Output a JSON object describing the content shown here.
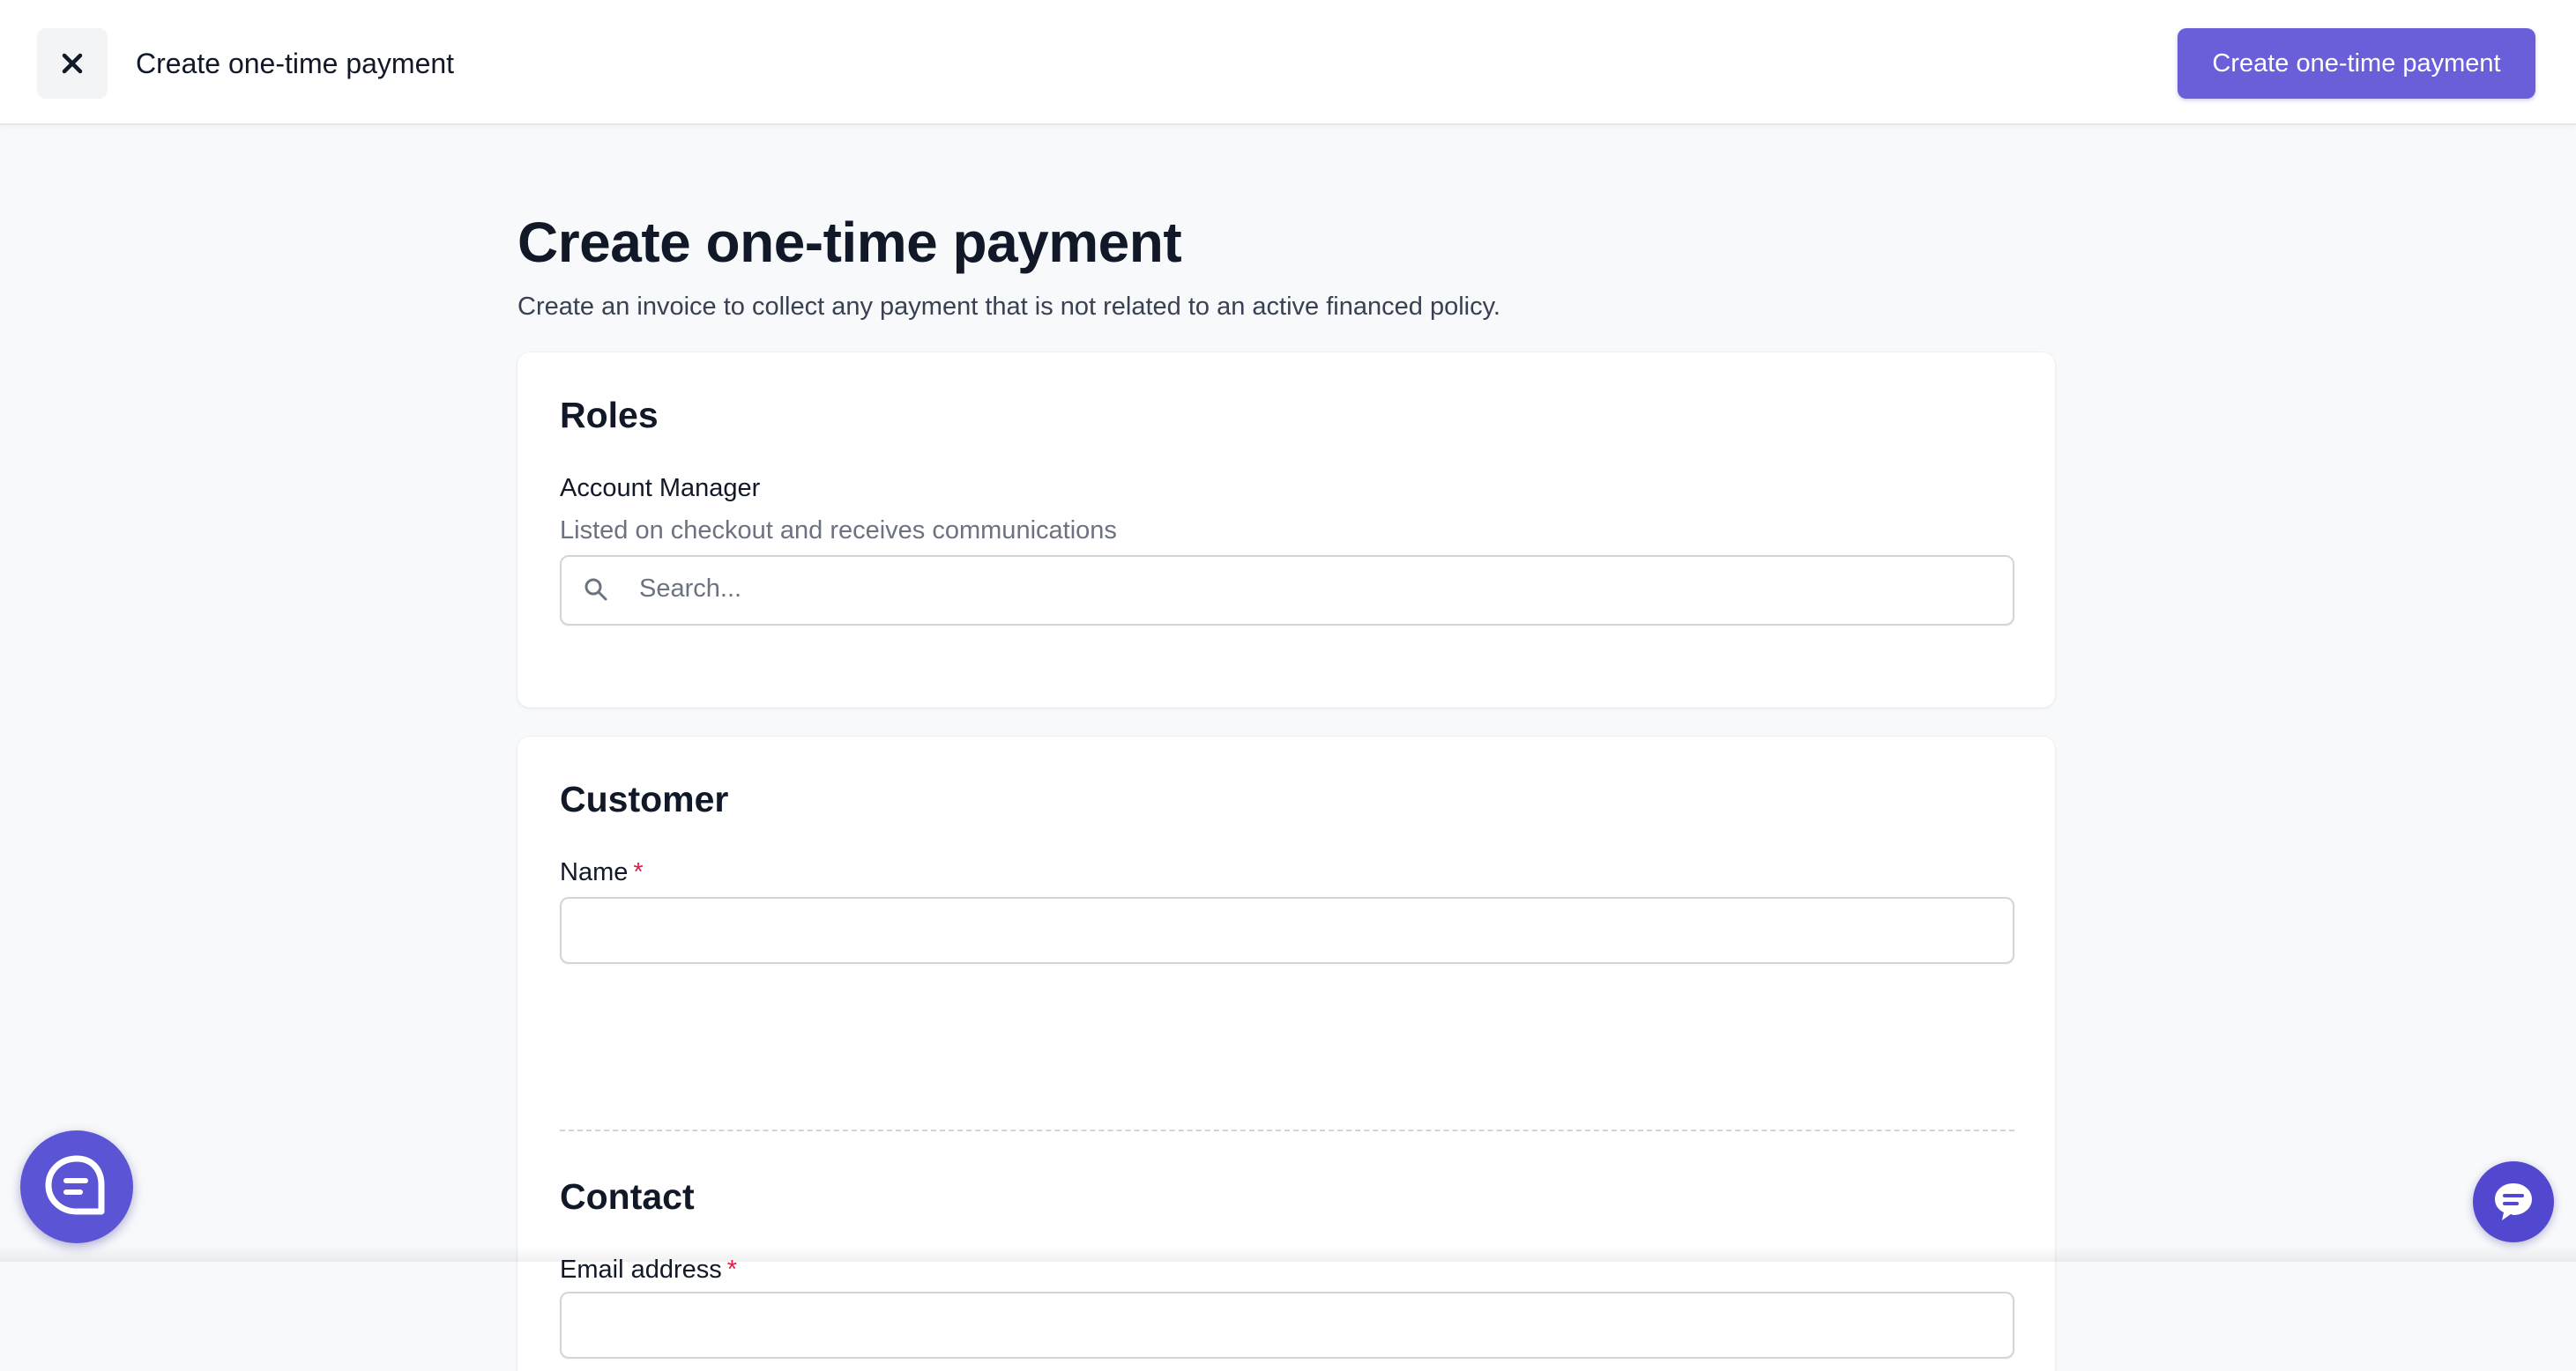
{
  "header": {
    "title": "Create one-time payment",
    "primary_action_label": "Create one-time payment",
    "close_icon": "close-icon"
  },
  "page": {
    "title": "Create one-time payment",
    "subtitle": "Create an invoice to collect any payment that is not related to an active financed policy."
  },
  "roles": {
    "section_title": "Roles",
    "account_manager_label": "Account Manager",
    "account_manager_help": "Listed on checkout and receives communications",
    "search_placeholder": "Search...",
    "search_icon": "search-icon"
  },
  "customer": {
    "section_title": "Customer",
    "name_label": "Name",
    "name_required": "*",
    "name_value": ""
  },
  "contact": {
    "section_title": "Contact",
    "email_label": "Email address",
    "email_required": "*",
    "email_value": ""
  },
  "widgets": {
    "left_chat_icon": "chat-bubble-icon",
    "right_chat_icon": "message-icon"
  },
  "colors": {
    "primary": "#6a5fd8",
    "required": "#e11d48",
    "background": "#f8f9fb",
    "widget": "#5b55d6"
  }
}
